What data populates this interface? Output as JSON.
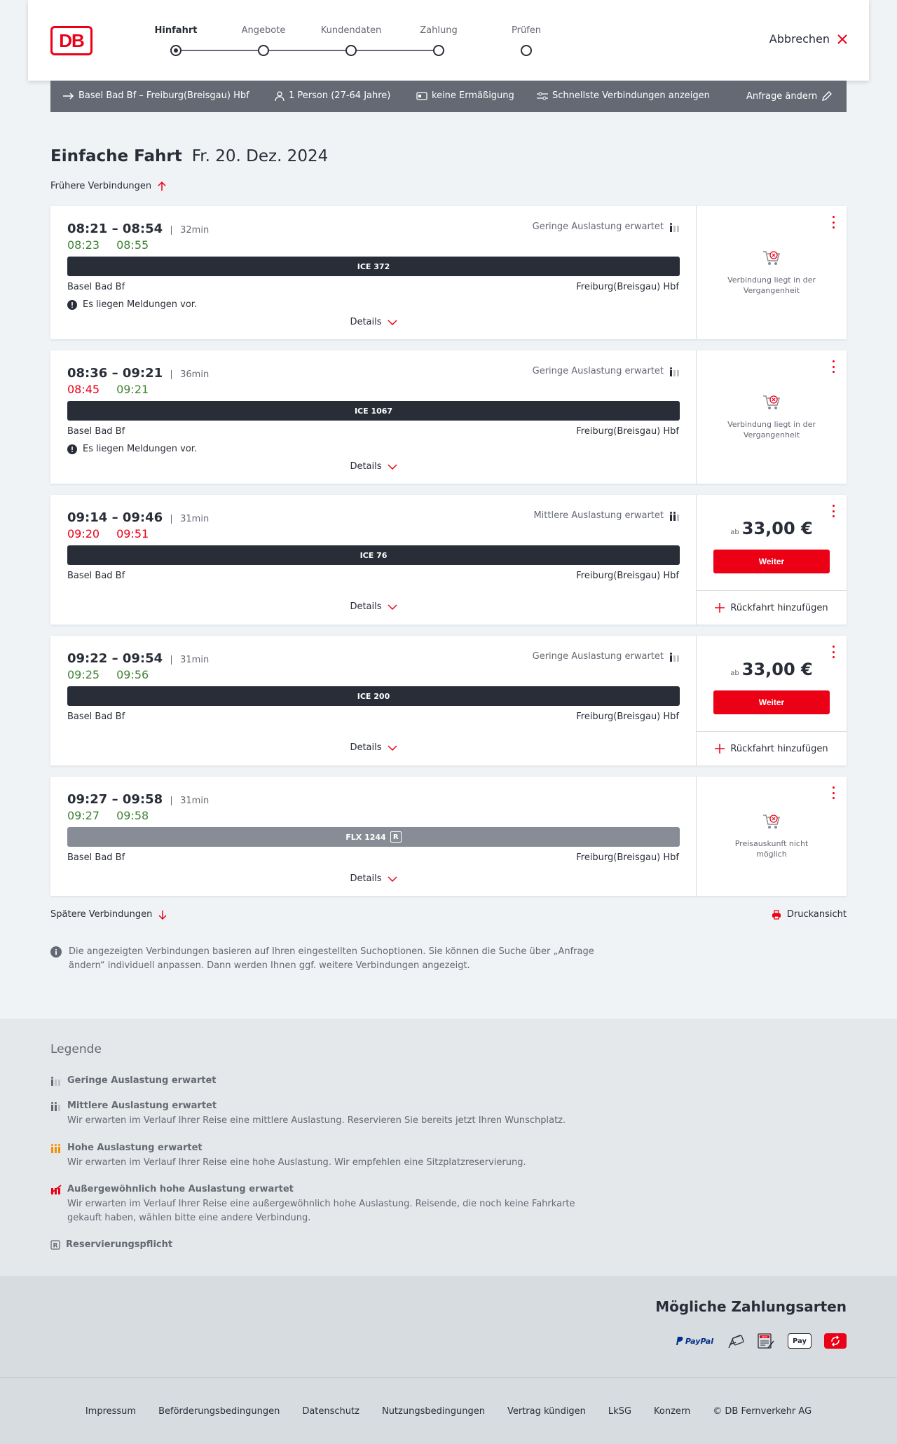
{
  "header": {
    "logo": "DB",
    "steps": [
      "Hinfahrt",
      "Angebote",
      "Kundendaten",
      "Zahlung",
      "Prüfen"
    ],
    "active_step": 0,
    "cancel": "Abbrechen"
  },
  "search": {
    "route": "Basel Bad Bf – Freiburg(Breisgau) Hbf",
    "persons": "1 Person (27-64 Jahre)",
    "discount": "keine Ermäßigung",
    "fastest": "Schnellste Verbindungen anzeigen",
    "change": "Anfrage ändern"
  },
  "page": {
    "title": "Einfache Fahrt",
    "date": "Fr. 20. Dez. 2024",
    "earlier": "Frühere Verbindungen",
    "later": "Spätere Verbindungen",
    "print": "Druckansicht",
    "info": "Die angezeigten Verbindungen basieren auf Ihren eingestellten Suchoptionen. Sie können die Suche über „Anfrage ändern“ individuell anpassen. Dann werden Ihnen ggf. weitere Verbindungen angezeigt.",
    "details_label": "Details",
    "ab": "ab",
    "weiter": "Weiter",
    "rueckfahrt": "Rückfahrt hinzufügen",
    "past_text": "Verbindung liegt in der Vergangenheit",
    "noprice_text": "Preisauskunft nicht möglich",
    "message": "Es liegen Meldungen vor."
  },
  "connections": [
    {
      "times": "08:21 – 08:54",
      "duration": "32min",
      "rt_dep": "08:23",
      "rt_arr": "08:55",
      "dep_delay": false,
      "arr_delay": false,
      "load": "Geringe Auslastung erwartet",
      "train": "ICE 372",
      "from": "Basel Bad Bf",
      "to": "Freiburg(Breisgau) Hbf"
    },
    {
      "times": "08:36 – 09:21",
      "duration": "36min",
      "rt_dep": "08:45",
      "rt_arr": "09:21",
      "dep_delay": true,
      "arr_delay": false,
      "load": "Geringe Auslastung erwartet",
      "train": "ICE 1067",
      "from": "Basel Bad Bf",
      "to": "Freiburg(Breisgau) Hbf"
    },
    {
      "times": "09:14 – 09:46",
      "duration": "31min",
      "rt_dep": "09:20",
      "rt_arr": "09:51",
      "dep_delay": true,
      "arr_delay": true,
      "load": "Mittlere Auslastung erwartet",
      "train": "ICE 76",
      "from": "Basel Bad Bf",
      "to": "Freiburg(Breisgau) Hbf",
      "price": "33,00 €"
    },
    {
      "times": "09:22 – 09:54",
      "duration": "31min",
      "rt_dep": "09:25",
      "rt_arr": "09:56",
      "dep_delay": false,
      "arr_delay": false,
      "load": "Geringe Auslastung erwartet",
      "train": "ICE 200",
      "from": "Basel Bad Bf",
      "to": "Freiburg(Breisgau) Hbf",
      "price": "33,00 €"
    },
    {
      "times": "09:27 – 09:58",
      "duration": "31min",
      "rt_dep": "09:27",
      "rt_arr": "09:58",
      "dep_delay": false,
      "arr_delay": false,
      "train": "FLX 1244",
      "train_badge": "R",
      "from": "Basel Bad Bf",
      "to": "Freiburg(Breisgau) Hbf"
    }
  ],
  "legend": {
    "title": "Legende",
    "items": [
      {
        "title": "Geringe Auslastung erwartet",
        "desc": ""
      },
      {
        "title": "Mittlere Auslastung erwartet",
        "desc": "Wir erwarten im Verlauf Ihrer Reise eine mittlere Auslastung. Reservieren Sie bereits jetzt Ihren Wunschplatz."
      },
      {
        "title": "Hohe Auslastung erwartet",
        "desc": "Wir erwarten im Verlauf Ihrer Reise eine hohe Auslastung. Wir empfehlen eine Sitzplatzreservierung."
      },
      {
        "title": "Außergewöhnlich hohe Auslastung erwartet",
        "desc": "Wir erwarten im Verlauf Ihrer Reise eine außergewöhnlich hohe Auslastung. Reisende, die noch keine Fahrkarte gekauft haben, wählen bitte eine andere Verbindung."
      },
      {
        "title": "Reservierungspflicht",
        "desc": ""
      }
    ]
  },
  "payment": {
    "title": "Mögliche Zahlungsarten",
    "paypal": "PayPal",
    "applepay": "Pay",
    "sepa": "SEPA"
  },
  "footer": {
    "links": [
      "Impressum",
      "Beförderungsbedingungen",
      "Datenschutz",
      "Nutzungsbedingungen",
      "Vertrag kündigen",
      "LkSG",
      "Konzern",
      "© DB Fernverkehr AG"
    ]
  },
  "colors": {
    "accent": "#ec0016",
    "on_time": "#408335",
    "dark": "#282d37",
    "grey": "#646973",
    "orange": "#f39200"
  }
}
